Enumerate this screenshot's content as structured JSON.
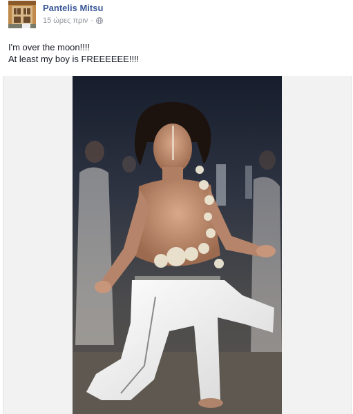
{
  "post": {
    "author": "Pantelis Mitsu",
    "timestamp": "15 ώρες πριν",
    "privacy_icon": "globe-icon",
    "message_lines": [
      "I'm over the moon!!!!",
      "At least my boy is FREEEEEE!!!!"
    ],
    "avatar_icon": "building-window-avatar",
    "photo_subject": "runway-model-photo"
  },
  "colors": {
    "author_link": "#3b5998",
    "meta_text": "#90949c",
    "body_text": "#141823",
    "photo_backdrop": "#f2f2f2"
  }
}
